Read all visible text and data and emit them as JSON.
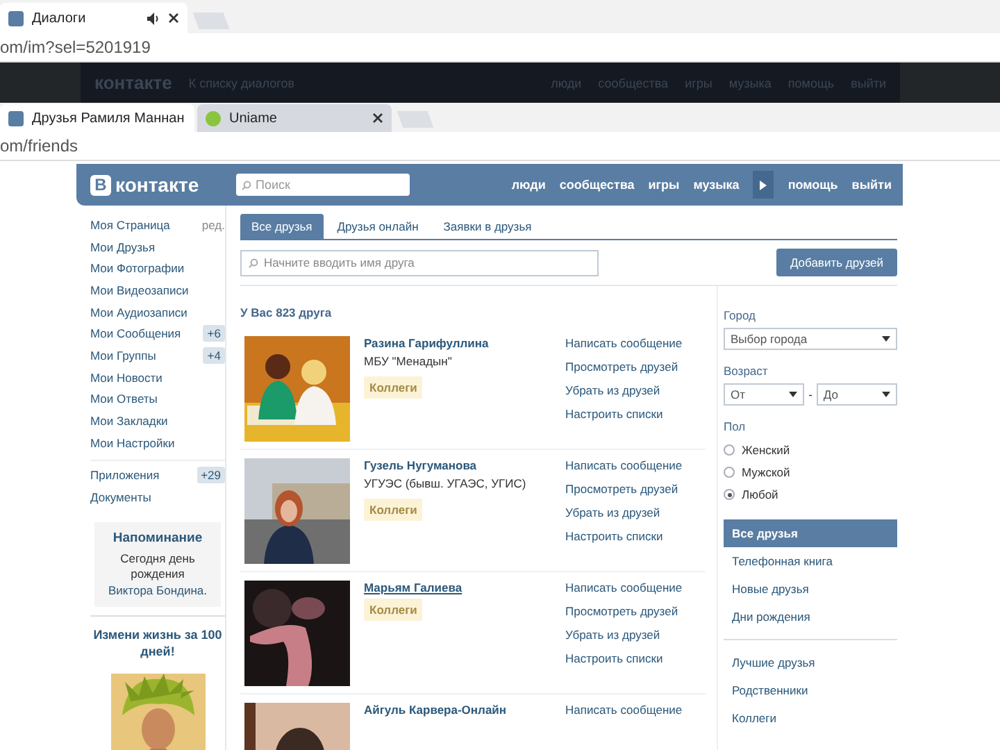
{
  "background_window": {
    "tabs": [
      {
        "title": "Диалоги",
        "selected": true,
        "audio": true
      }
    ],
    "address": "om/im?sel=5201919",
    "page_header": {
      "logo": "контакте",
      "back_link": "К списку диалогов",
      "nav": [
        "люди",
        "сообщества",
        "игры",
        "музыка"
      ],
      "nav_right": [
        "помощь",
        "выйти"
      ]
    }
  },
  "window": {
    "tabs": [
      {
        "title": "Друзья Рамиля Маннан",
        "selected": true,
        "kind": "vk"
      },
      {
        "title": "Uniame",
        "selected": false,
        "kind": "other"
      }
    ],
    "address": "om/friends"
  },
  "header": {
    "logo_mark": "В",
    "logo": "контакте",
    "search": {
      "placeholder": "Поиск"
    },
    "nav": [
      "люди",
      "сообщества",
      "игры",
      "музыка"
    ],
    "nav_right": [
      "помощь",
      "выйти"
    ]
  },
  "sidebar": {
    "items": [
      {
        "label": "Моя Страница",
        "extra": "ред."
      },
      {
        "label": "Мои Друзья"
      },
      {
        "label": "Мои Фотографии"
      },
      {
        "label": "Мои Видеозаписи"
      },
      {
        "label": "Мои Аудиозаписи"
      },
      {
        "label": "Мои Сообщения",
        "counter": "+6"
      },
      {
        "label": "Мои Группы",
        "counter": "+4"
      },
      {
        "label": "Мои Новости"
      },
      {
        "label": "Мои Ответы"
      },
      {
        "label": "Мои Закладки"
      },
      {
        "label": "Мои Настройки"
      }
    ],
    "apps": [
      {
        "label": "Приложения",
        "counter": "+29"
      },
      {
        "label": "Документы"
      }
    ],
    "reminder": {
      "title": "Напоминание",
      "text_before": "Сегодня день рождения",
      "link": "Виктора Бондина",
      "text_after": "."
    },
    "ad": {
      "title": "Измени жизнь за 100 дней!",
      "kind": "picture"
    }
  },
  "main": {
    "tabs": [
      {
        "label": "Все друзья",
        "selected": true
      },
      {
        "label": "Друзья онлайн",
        "selected": false
      },
      {
        "label": "Заявки в друзья",
        "selected": false
      }
    ],
    "search": {
      "placeholder": "Начните вводить имя друга"
    },
    "add_button": "Добавить друзей",
    "count": "У Вас 823 друга",
    "friends": [
      {
        "name": "Разина Гарифуллина",
        "subtitle": "МБУ \"Менадын\"",
        "tag": "Коллеги",
        "hovered": false,
        "actions": [
          "Написать сообщение",
          "Просмотреть друзей",
          "Убрать из друзей",
          "Настроить списки"
        ]
      },
      {
        "name": "Гузель Нугуманова",
        "subtitle": "УГУЭС (бывш. УГАЭС, УГИС)",
        "tag": "Коллеги",
        "hovered": false,
        "actions": [
          "Написать сообщение",
          "Просмотреть друзей",
          "Убрать из друзей",
          "Настроить списки"
        ]
      },
      {
        "name": "Марьям Галиева",
        "tag": "Коллеги",
        "hovered": true,
        "actions": [
          "Написать сообщение",
          "Просмотреть друзей",
          "Убрать из друзей",
          "Настроить списки"
        ]
      },
      {
        "name": "Айгуль Карвера-Онлайн",
        "hovered": false,
        "actions": [
          "Написать сообщение"
        ]
      }
    ]
  },
  "filters": {
    "city": {
      "label": "Город",
      "value": "Выбор города"
    },
    "age": {
      "label": "Возраст",
      "from": "От",
      "dash": "-",
      "to": "До"
    },
    "gender": {
      "label": "Пол",
      "options": [
        {
          "label": "Женский",
          "selected": false
        },
        {
          "label": "Мужской",
          "selected": false
        },
        {
          "label": "Любой",
          "selected": true
        }
      ]
    },
    "lists": [
      {
        "label": "Все друзья",
        "selected": true
      },
      {
        "label": "Телефонная книга",
        "selected": false
      },
      {
        "label": "Новые друзья",
        "selected": false
      },
      {
        "label": "Дни рождения",
        "selected": false
      }
    ],
    "lists_more": [
      {
        "label": "Лучшие друзья",
        "selected": false
      },
      {
        "label": "Родственники",
        "selected": false
      },
      {
        "label": "Коллеги",
        "selected": false
      }
    ]
  }
}
